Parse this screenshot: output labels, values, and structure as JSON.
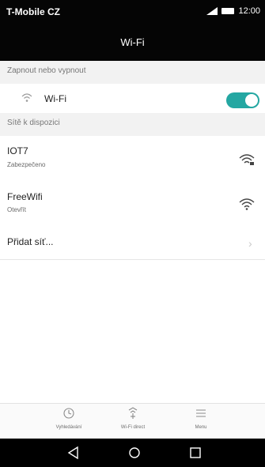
{
  "status_bar": {
    "carrier": "T-Mobile CZ",
    "time": "12:00"
  },
  "header": {
    "title": "Wi-Fi"
  },
  "sections": {
    "toggle_section": "Zapnout nebo vypnout",
    "available_section": "Sítě k dispozici"
  },
  "wifi_toggle": {
    "label": "Wi-Fi",
    "state": "on",
    "accent": "#24a7a2"
  },
  "networks": [
    {
      "name": "IOT7",
      "status": "Zabezpečeno",
      "icon": "wifi-locked-icon"
    },
    {
      "name": "FreeWifi",
      "status": "Otevřít",
      "icon": "wifi-icon"
    }
  ],
  "add_network": {
    "label": "Přidat síť..."
  },
  "bottom_bar": {
    "items": [
      {
        "label": "Vyhledávání",
        "icon": "refresh-scan-icon"
      },
      {
        "label": "Wi-Fi direct",
        "icon": "wifi-direct-icon"
      },
      {
        "label": "Menu",
        "icon": "menu-icon"
      }
    ]
  },
  "nav_bar": {
    "buttons": [
      "back-icon",
      "home-icon",
      "recents-icon"
    ]
  }
}
